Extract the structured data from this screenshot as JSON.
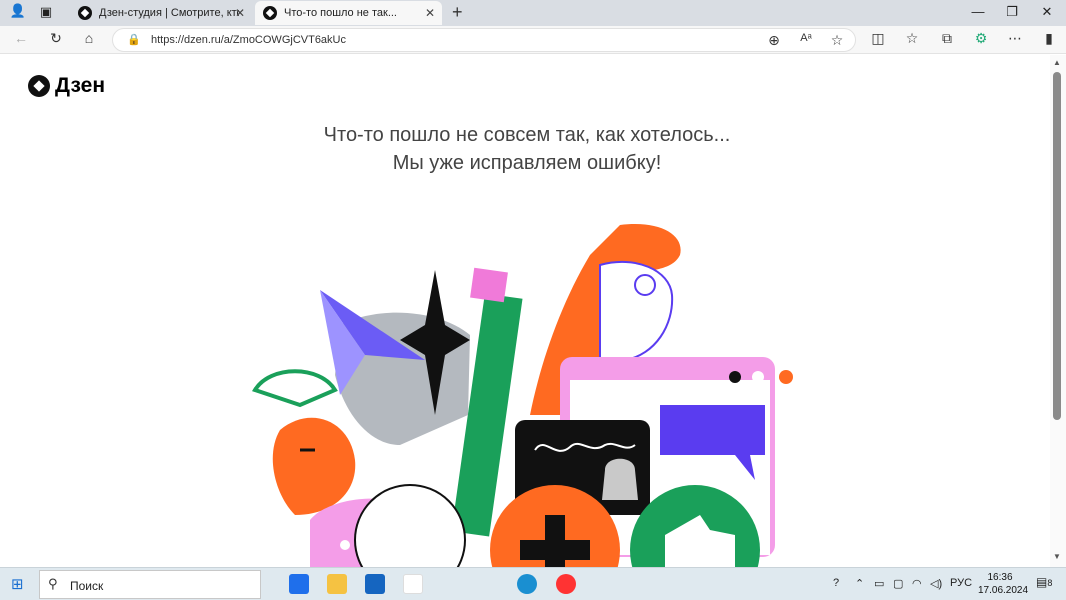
{
  "browser": {
    "tabs": [
      {
        "title": "Дзен-студия | Смотрите, кто ра:"
      },
      {
        "title": "Что-то пошло не так..."
      }
    ],
    "url": "https://dzen.ru/a/ZmoCOWGjCVT6akUc"
  },
  "page": {
    "logo": "Дзен",
    "message_line1": "Что-то пошло не совсем так, как хотелось...",
    "message_line2": "Мы уже исправляем ошибку!"
  },
  "taskbar": {
    "search_placeholder": "Поиск",
    "language": "РУС",
    "time": "16:36",
    "date": "17.06.2024",
    "notifications": "8"
  }
}
